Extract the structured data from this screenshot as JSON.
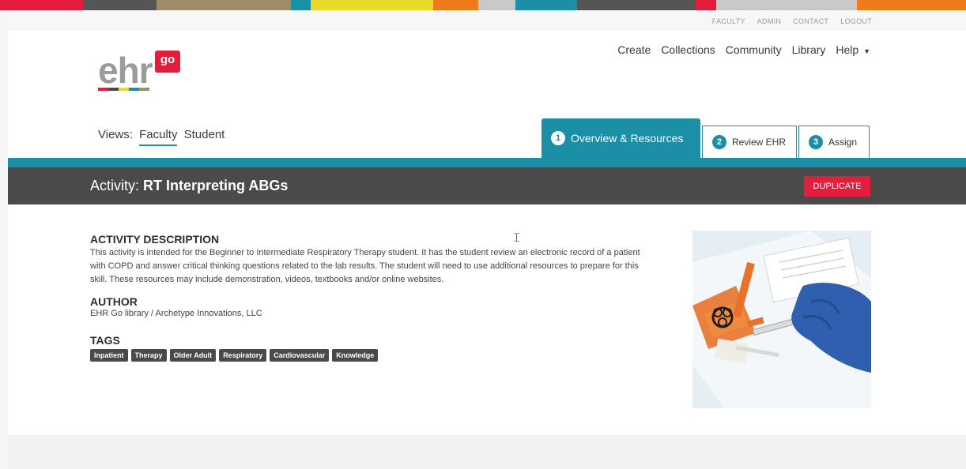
{
  "colors": {
    "teal": "#1a8fa6",
    "brand_red": "#e31d3c",
    "dark_bar": "#4a4a4a",
    "stripe": [
      "#e31d3c",
      "#555555",
      "#a08c6a",
      "#1a8fa6",
      "#e8d92a",
      "#ef7a1a",
      "#c9c9c9",
      "#1a8fa6",
      "#555555",
      "#e31d3c",
      "#c9c9c9",
      "#ef7a1a"
    ]
  },
  "utility_nav": [
    "FACULTY",
    "ADMIN",
    "CONTACT",
    "LOGOUT"
  ],
  "logo": {
    "text": "ehr",
    "badge": "go"
  },
  "main_nav": {
    "create": "Create",
    "collections": "Collections",
    "community": "Community",
    "library": "Library",
    "help": "Help",
    "help_caret": "▼"
  },
  "views": {
    "label": "Views:",
    "faculty": "Faculty",
    "student": "Student"
  },
  "tabs": [
    {
      "num": "1",
      "label": "Overview & Resources"
    },
    {
      "num": "2",
      "label": "Review EHR"
    },
    {
      "num": "3",
      "label": "Assign"
    }
  ],
  "activity": {
    "prefix": "Activity:",
    "name": "RT Interpreting ABGs"
  },
  "duplicate_label": "DUPLICATE",
  "description": {
    "heading": "ACTIVITY DESCRIPTION",
    "text": "This activity is intended for the Beginner to Intermediate Respiratory Therapy student. It has the student review an electronic record of a patient with COPD and answer critical thinking questions related to the lab results. The student will need to use additional resources to prepare for this skill. These resources may include demonstration, videos, textbooks and/or online websites."
  },
  "author": {
    "heading": "AUTHOR",
    "text": "EHR Go library / Archetype Innovations, LLC"
  },
  "tags": {
    "heading": "TAGS",
    "items": [
      "Inpatient",
      "Therapy",
      "Older Adult",
      "Respiratory",
      "Cardiovascular",
      "Knowledge"
    ]
  }
}
